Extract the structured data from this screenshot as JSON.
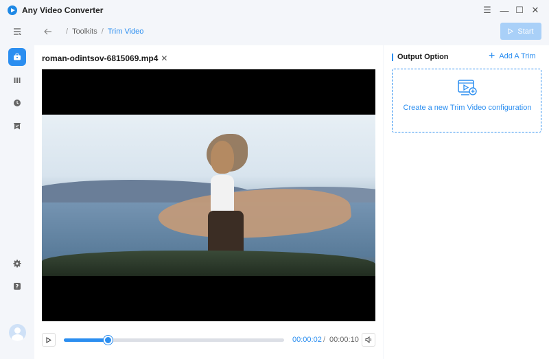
{
  "app": {
    "title": "Any Video Converter"
  },
  "window_controls": {
    "menu": "☰",
    "minimize": "—",
    "maximize": "☐",
    "close": "✕"
  },
  "sidebar": {
    "items": [
      {
        "name": "menu",
        "icon": "menu-icon"
      },
      {
        "name": "toolkits",
        "icon": "toolbox-icon",
        "active": true
      },
      {
        "name": "library",
        "icon": "library-icon"
      },
      {
        "name": "history",
        "icon": "clock-icon"
      },
      {
        "name": "tasks",
        "icon": "bookmark-check-icon"
      },
      {
        "name": "settings",
        "icon": "gear-icon"
      },
      {
        "name": "help",
        "icon": "help-icon"
      }
    ],
    "avatar": "user-avatar-icon"
  },
  "breadcrumb": {
    "parent": "Toolkits",
    "separator": "/",
    "current": "Trim Video"
  },
  "toolbar": {
    "start_label": "Start"
  },
  "video": {
    "filename": "roman-odintsov-6815069.mp4",
    "current_time": "00:00:02",
    "time_separator": "/",
    "total_time": "00:00:10",
    "progress": 0.2
  },
  "output": {
    "title": "Output Option",
    "add_label": "Add A Trim",
    "card_text": "Create a new Trim Video configuration"
  },
  "colors": {
    "accent": "#2b8ef0",
    "start_disabled": "#a9d0f8"
  }
}
